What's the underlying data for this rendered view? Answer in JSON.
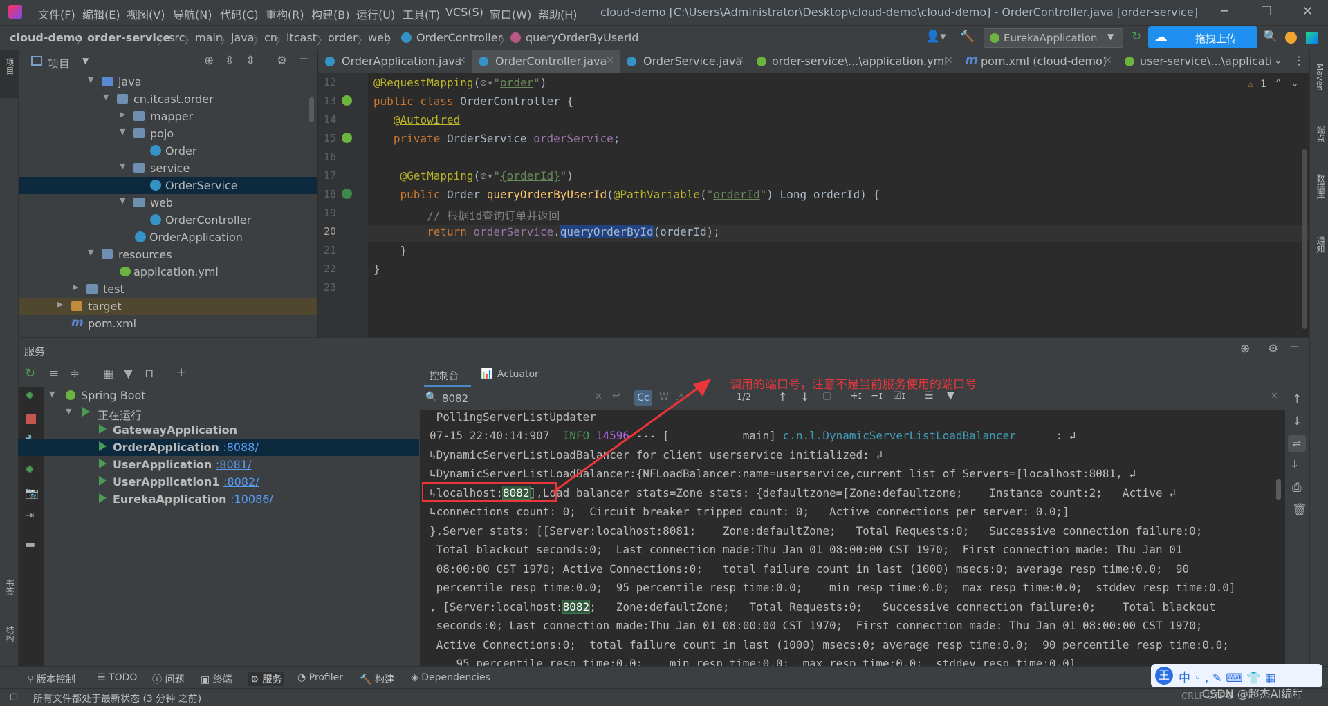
{
  "menu": {
    "items": [
      "文件(F)",
      "编辑(E)",
      "视图(V)",
      "导航(N)",
      "代码(C)",
      "重构(R)",
      "构建(B)",
      "运行(U)",
      "工具(T)",
      "VCS(S)",
      "窗口(W)",
      "帮助(H)"
    ],
    "window_title": "cloud-demo [C:\\Users\\Administrator\\Desktop\\cloud-demo\\cloud-demo] - OrderController.java [order-service]"
  },
  "breadcrumb": [
    "cloud-demo",
    "order-service",
    "src",
    "main",
    "java",
    "cn",
    "itcast",
    "order",
    "web",
    "OrderController",
    "queryOrderByUserId"
  ],
  "toolbar": {
    "run_config": "EurekaApplication",
    "upload_label": "拖拽上传"
  },
  "project_panel": {
    "title": "项目",
    "tree": [
      {
        "label": "java",
        "indent": 1,
        "icon": "folder-b",
        "arrow": "down"
      },
      {
        "label": "cn.itcast.order",
        "indent": 2,
        "icon": "folder",
        "arrow": "down"
      },
      {
        "label": "mapper",
        "indent": 3,
        "icon": "folder",
        "arrow": "right"
      },
      {
        "label": "pojo",
        "indent": 3,
        "icon": "folder",
        "arrow": "down"
      },
      {
        "label": "Order",
        "indent": 4,
        "icon": "cls",
        "arrow": ""
      },
      {
        "label": "service",
        "indent": 3,
        "icon": "folder",
        "arrow": "down"
      },
      {
        "label": "OrderService",
        "indent": 4,
        "icon": "cls",
        "arrow": "",
        "selected": true
      },
      {
        "label": "web",
        "indent": 3,
        "icon": "folder",
        "arrow": "down"
      },
      {
        "label": "OrderController",
        "indent": 4,
        "icon": "cls",
        "arrow": ""
      },
      {
        "label": "OrderApplication",
        "indent": 3,
        "icon": "cls",
        "arrow": ""
      },
      {
        "label": "resources",
        "indent": 1,
        "icon": "folder",
        "arrow": "down"
      },
      {
        "label": "application.yml",
        "indent": 2,
        "icon": "yml",
        "arrow": ""
      },
      {
        "label": "test",
        "indent": 0,
        "icon": "folder",
        "arrow": "right"
      },
      {
        "label": "target",
        "indent": -1,
        "icon": "folder-o",
        "arrow": "right",
        "highlight": true
      },
      {
        "label": "pom.xml",
        "indent": -1,
        "icon": "pom",
        "arrow": ""
      }
    ]
  },
  "editor": {
    "tabs": [
      {
        "label": "OrderApplication.java",
        "active": false
      },
      {
        "label": "OrderController.java",
        "active": true
      },
      {
        "label": "OrderService.java",
        "active": false
      },
      {
        "label": "order-service\\...\\application.yml",
        "active": false
      },
      {
        "label": "pom.xml (cloud-demo)",
        "active": false
      },
      {
        "label": "user-service\\...\\applicati",
        "active": false
      }
    ],
    "warning_count": "1",
    "line_numbers": [
      "12",
      "13",
      "14",
      "15",
      "16",
      "17",
      "18",
      "19",
      "20",
      "21",
      "22",
      "23"
    ]
  },
  "services": {
    "title": "服务",
    "spring_boot": "Spring Boot",
    "running": "正在运行",
    "apps": [
      {
        "name": "GatewayApplication",
        "port": ""
      },
      {
        "name": "OrderApplication",
        "port": ":8088/"
      },
      {
        "name": "UserApplication",
        "port": ":8081/"
      },
      {
        "name": "UserApplication1",
        "port": ":8082/"
      },
      {
        "name": "EurekaApplication",
        "port": ":10086/"
      }
    ]
  },
  "console": {
    "tab_console": "控制台",
    "tab_actuator": "Actuator",
    "search_value": "8082",
    "match_count": "1/2",
    "annotation": "调用的端口号，注意不是当前服务使用的端口号"
  },
  "bottom_tabs": [
    "版本控制",
    "TODO",
    "问题",
    "终端",
    "服务",
    "Profiler",
    "构建",
    "Dependencies"
  ],
  "status": {
    "text": "所有文件都处于最新状态 (3 分钟 之前)",
    "right": "CRLF  UTF-8",
    "watermark": "CSDN @超杰AI编程"
  },
  "right_strip": [
    "Maven",
    "端点",
    "数据库",
    "通知"
  ],
  "left_strip": [
    "项目",
    "书签",
    "结构"
  ]
}
